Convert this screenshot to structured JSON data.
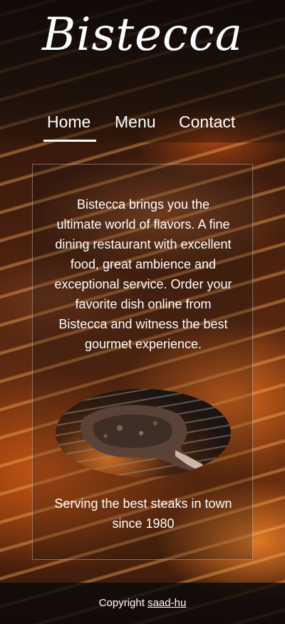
{
  "header": {
    "brand": "Bistecca"
  },
  "nav": {
    "items": [
      {
        "label": "Home",
        "active": true
      },
      {
        "label": "Menu",
        "active": false
      },
      {
        "label": "Contact",
        "active": false
      }
    ]
  },
  "main": {
    "intro": "Bistecca brings you the ultimate world of flavors. A fine dining restaurant with excellent food, great ambience and exceptional service. Order your favorite dish online from Bistecca and witness the best gourmet experience.",
    "tagline": "Serving the best steaks in town since 1980"
  },
  "footer": {
    "copyright_label": "Copyright",
    "author_link": "saad-hu"
  },
  "colors": {
    "text": "#ffffff",
    "header_bg": "#0f0a08",
    "accent_fire": "#e0701e"
  }
}
